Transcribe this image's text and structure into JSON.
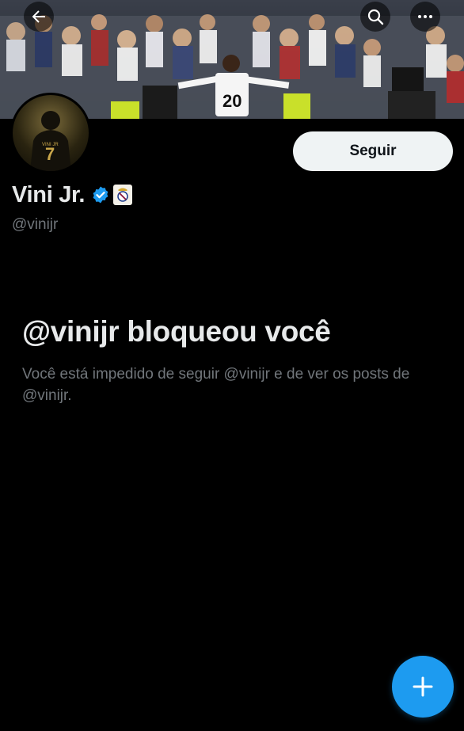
{
  "header": {
    "back_icon": "arrow-left-icon",
    "search_icon": "search-icon",
    "more_icon": "more-horizontal-icon"
  },
  "profile": {
    "display_name": "Vini Jr.",
    "handle": "@vinijr",
    "verified": true,
    "follow_label": "Seguir"
  },
  "blocked": {
    "title": "@vinijr bloqueou você",
    "description": "Você está impedido de seguir @vinijr e de ver os posts de @vinijr."
  },
  "fab": {
    "icon": "plus-icon"
  },
  "colors": {
    "background": "#000000",
    "accent": "#1d9bf0",
    "primary_text": "#e7e9ea",
    "secondary_text": "#71767b",
    "follow_button_bg": "#eff3f4"
  }
}
